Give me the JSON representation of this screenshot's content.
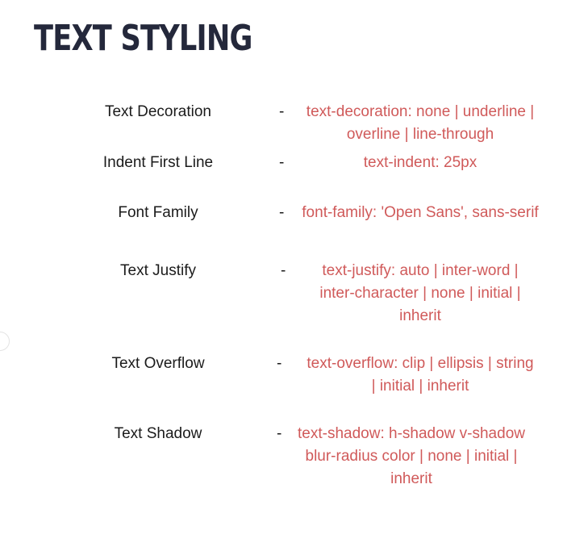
{
  "title": "TEXT STYLING",
  "separator": "-",
  "rows": [
    {
      "property": "Text Decoration",
      "value_lines": [
        "text-decoration: none | underline |",
        "overline | line-through"
      ]
    },
    {
      "property": "Indent First Line",
      "value_lines": [
        "text-indent: 25px"
      ]
    },
    {
      "property": "Font Family",
      "value_lines": [
        "font-family: 'Open Sans', sans-serif"
      ]
    },
    {
      "property": "Text Justify",
      "value_lines": [
        "text-justify: auto | inter-word |",
        "inter-character | none | initial |",
        "inherit"
      ]
    },
    {
      "property": "Text Overflow",
      "value_lines": [
        "text-overflow: clip | ellipsis | string",
        "| initial | inherit"
      ]
    },
    {
      "property": "Text Shadow",
      "value_lines": [
        "text-shadow: h-shadow v-shadow",
        "blur-radius color | none | initial |",
        "inherit"
      ]
    }
  ],
  "colors": {
    "title": "#24283b",
    "property_text": "#1b1b1b",
    "value_text": "#d05a5a",
    "background": "#ffffff"
  }
}
